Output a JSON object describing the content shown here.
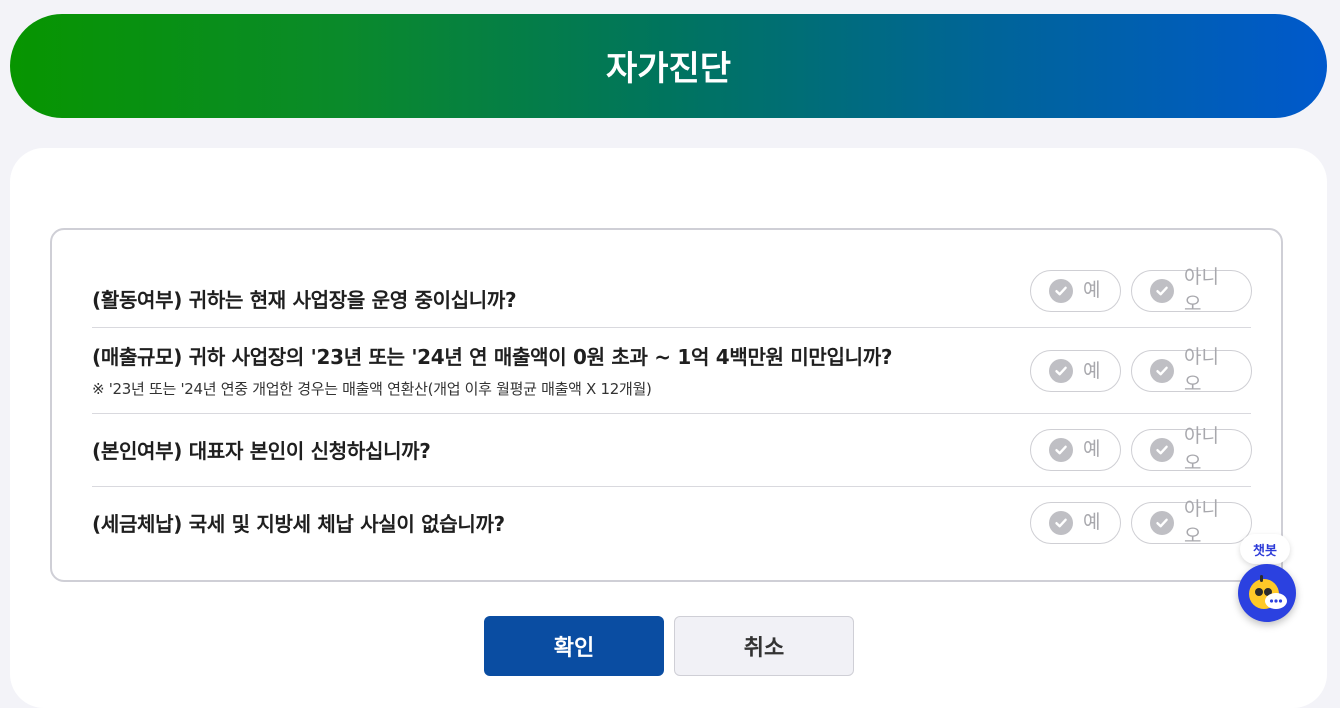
{
  "header": {
    "title": "자가진단"
  },
  "questions": [
    {
      "title": "(활동여부) 귀하는 현재 사업장을 운영 중이십니까?",
      "note": "",
      "yes_label": "예",
      "no_label": "아니오"
    },
    {
      "title": "(매출규모) 귀하 사업장의 '23년 또는 '24년 연 매출액이 0원 초과 ~ 1억 4백만원 미만입니까?",
      "note": "※ '23년 또는 '24년 연중 개업한 경우는 매출액 연환산(개업 이후 월평균 매출액 X 12개월)",
      "yes_label": "예",
      "no_label": "아니오"
    },
    {
      "title": "(본인여부) 대표자 본인이 신청하십니까?",
      "note": "",
      "yes_label": "예",
      "no_label": "아니오"
    },
    {
      "title": "(세금체납) 국세 및 지방세 체납 사실이 없습니까?",
      "note": "",
      "yes_label": "예",
      "no_label": "아니오"
    }
  ],
  "actions": {
    "confirm_label": "확인",
    "cancel_label": "취소"
  },
  "chatbot": {
    "label": "챗봇"
  },
  "colors": {
    "header_gradient_start": "#079500",
    "header_gradient_end": "#0059cc",
    "confirm_button": "#0a4da2",
    "chatbot": "#2b41e0",
    "check_inactive": "#bfbfc4"
  }
}
